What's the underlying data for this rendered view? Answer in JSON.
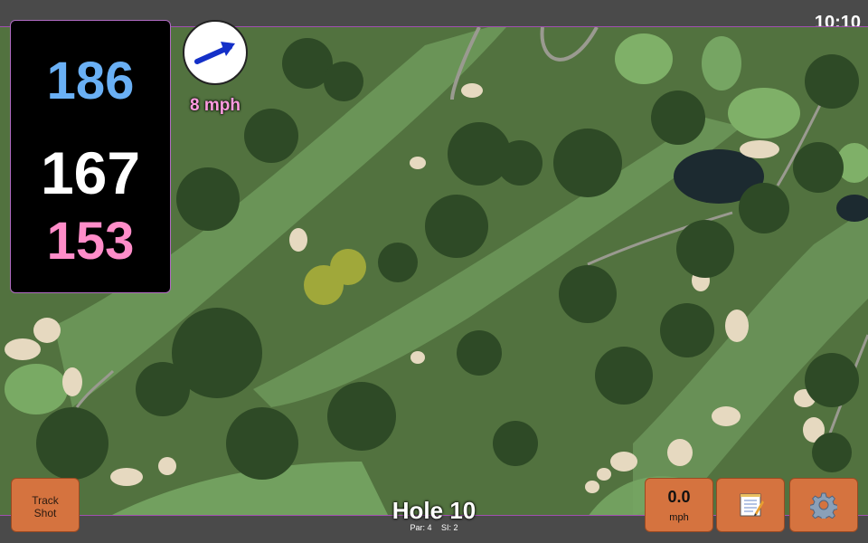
{
  "status": {
    "time": "10:10"
  },
  "distances": {
    "back": "186",
    "middle": "167",
    "front": "153"
  },
  "wind": {
    "speed_label": "8 mph",
    "icon": "wind-direction-arrow-icon"
  },
  "hole": {
    "title": "Hole 10",
    "par": "Par: 4",
    "stroke_index": "SI: 2"
  },
  "buttons": {
    "track_shot_line1": "Track",
    "track_shot_line2": "Shot",
    "speed_value": "0.0",
    "speed_unit": "mph",
    "notes_icon": "notepad-icon",
    "settings_icon": "gear-icon"
  },
  "colors": {
    "back": "#6ab0f5",
    "middle": "#ffffff",
    "front": "#ff8dc9",
    "wind_label": "#ff9be0",
    "button": "#d5733f",
    "border_accent": "#b06bc2"
  }
}
